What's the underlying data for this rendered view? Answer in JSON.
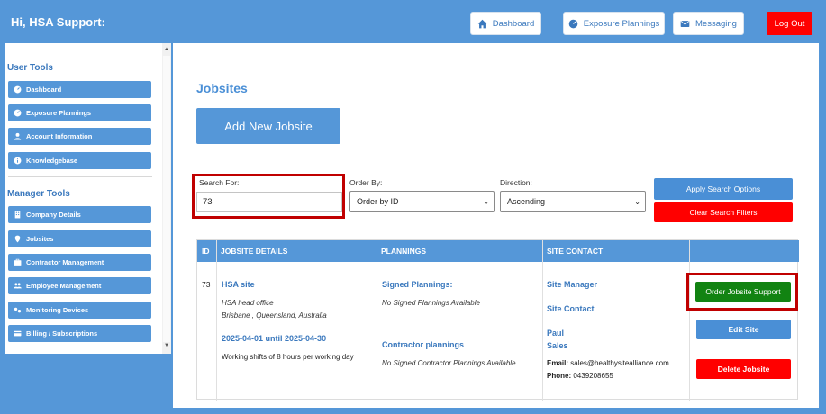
{
  "header": {
    "greeting": "Hi, HSA Support:",
    "nav": [
      {
        "label": "Dashboard",
        "icon": "home-icon"
      },
      {
        "label": "Exposure Plannings",
        "icon": "gauge-icon"
      },
      {
        "label": "Messaging",
        "icon": "envelope-icon"
      }
    ],
    "logout_label": "Log Out"
  },
  "sidebar": {
    "user_tools_title": "User Tools",
    "user_items": [
      {
        "label": "Dashboard",
        "icon": "gauge-icon"
      },
      {
        "label": "Exposure Plannings",
        "icon": "gauge-icon"
      },
      {
        "label": "Account Information",
        "icon": "user-icon"
      },
      {
        "label": "Knowledgebase",
        "icon": "info-icon"
      }
    ],
    "manager_tools_title": "Manager Tools",
    "manager_items": [
      {
        "label": "Company Details",
        "icon": "building-icon"
      },
      {
        "label": "Jobsites",
        "icon": "map-pin-icon"
      },
      {
        "label": "Contractor Management",
        "icon": "briefcase-icon"
      },
      {
        "label": "Employee Management",
        "icon": "users-icon"
      },
      {
        "label": "Monitoring Devices",
        "icon": "devices-icon"
      },
      {
        "label": "Billing / Subscriptions",
        "icon": "credit-card-icon"
      }
    ]
  },
  "main": {
    "title": "Jobsites",
    "add_button": "Add New Jobsite",
    "search": {
      "label": "Search For:",
      "value": "73"
    },
    "order_by": {
      "label": "Order By:",
      "selected": "Order by ID"
    },
    "direction": {
      "label": "Direction:",
      "selected": "Ascending"
    },
    "apply_button": "Apply Search Options",
    "clear_button": "Clear Search Filters",
    "table": {
      "headers": [
        "ID",
        "JOBSITE DETAILS",
        "PLANNINGS",
        "SITE CONTACT",
        ""
      ],
      "row": {
        "id": "73",
        "site_name": "HSA site",
        "office": "HSA head office",
        "address": "Brisbane , Queensland, Australia",
        "date_range": "2025-04-01 until 2025-04-30",
        "shifts": "Working shifts of 8 hours per working day",
        "signed_title": "Signed Plannings:",
        "signed_none": "No Signed Plannings Available",
        "contractor_title": "Contractor plannings",
        "contractor_none": "No Signed Contractor Plannings Available",
        "site_manager": "Site Manager",
        "site_contact": "Site Contact",
        "contact_name": "Paul",
        "contact_dept": "Sales",
        "email_label": "Email:",
        "email": "sales@healthysitealliance.com",
        "phone_label": "Phone:",
        "phone": "0439208655",
        "order_button": "Order Jobsite Support",
        "edit_button": "Edit Site",
        "delete_button": "Delete Jobsite"
      }
    }
  }
}
